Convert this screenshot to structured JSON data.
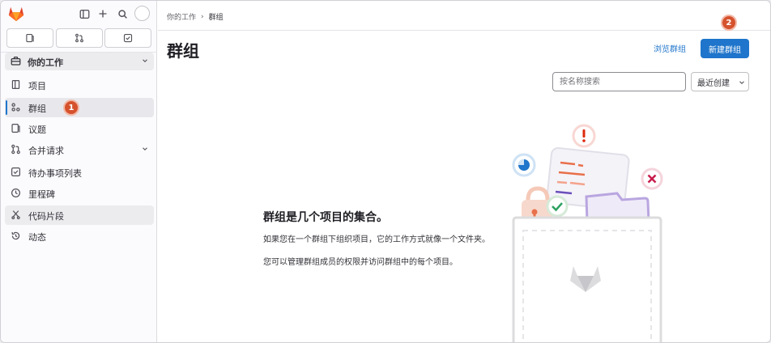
{
  "sidebar": {
    "section_label": "你的工作",
    "items": [
      {
        "label": "项目",
        "icon": "project-icon"
      },
      {
        "label": "群组",
        "icon": "group-icon"
      },
      {
        "label": "议题",
        "icon": "issues-icon"
      },
      {
        "label": "合并请求",
        "icon": "merge-request-icon"
      },
      {
        "label": "待办事项列表",
        "icon": "todo-icon"
      },
      {
        "label": "里程碑",
        "icon": "milestone-icon"
      },
      {
        "label": "代码片段",
        "icon": "snippet-icon"
      },
      {
        "label": "动态",
        "icon": "activity-icon"
      }
    ]
  },
  "breadcrumb": {
    "parent": "你的工作",
    "separator": "›",
    "current": "群组"
  },
  "page": {
    "title": "群组",
    "browse_link": "浏览群组",
    "new_button": "新建群组"
  },
  "filter": {
    "search_placeholder": "按名称搜索",
    "sort_label": "最近创建"
  },
  "empty_state": {
    "title": "群组是几个项目的集合。",
    "line1": "如果您在一个群组下组织项目，它的工作方式就像一个文件夹。",
    "line2": "您可以管理群组成员的权限并访问群组中的每个项目。"
  },
  "annotations": {
    "badge1": "1",
    "badge2": "2"
  },
  "colors": {
    "accent": "#1f75cb",
    "badge": "#d5522d",
    "logo": "#e24329"
  }
}
